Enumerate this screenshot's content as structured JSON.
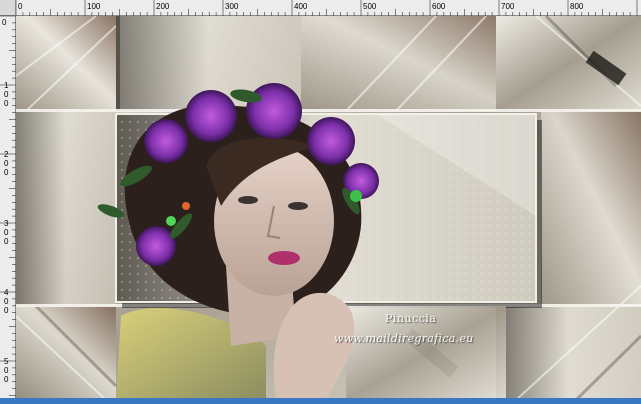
{
  "ruler": {
    "top_labels": [
      "0",
      "100",
      "200",
      "300",
      "400",
      "500",
      "600",
      "700",
      "800"
    ],
    "left_labels": [
      "0",
      "100",
      "200",
      "300",
      "400",
      "500"
    ]
  },
  "artwork": {
    "watermark_name": "Pinuccia",
    "watermark_site": "www.maildiregrafica.eu"
  },
  "colors": {
    "ruler_bg": "#ececec",
    "status_bar": "#3a78c4",
    "flower_purple": "#7b2fa8"
  }
}
